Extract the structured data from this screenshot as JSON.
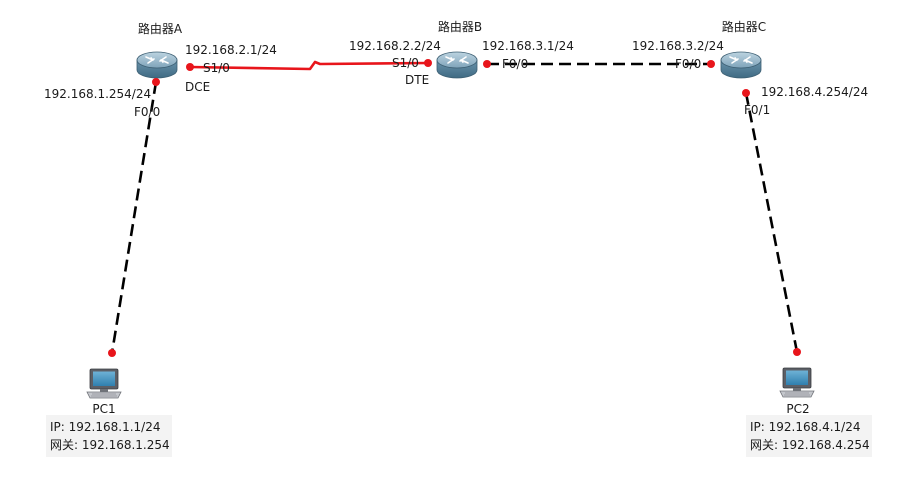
{
  "diagram": {
    "nodes": {
      "router_a": {
        "name": "路由器A"
      },
      "router_b": {
        "name": "路由器B"
      },
      "router_c": {
        "name": "路由器C"
      },
      "pc1": {
        "name": "PC1",
        "ip": "IP: 192.168.1.1/24",
        "gateway": "网关: 192.168.1.254"
      },
      "pc2": {
        "name": "PC2",
        "ip": "IP: 192.168.4.1/24",
        "gateway": "网关: 192.168.4.254"
      }
    },
    "interfaces": {
      "a_s10": {
        "port": "S1/0",
        "ip": "192.168.2.1/24",
        "role": "DCE"
      },
      "a_f00": {
        "port": "F0/0",
        "ip": "192.168.1.254/24"
      },
      "b_s10": {
        "port": "S1/0",
        "ip": "192.168.2.2/24",
        "role": "DTE"
      },
      "b_f00": {
        "port": "F0/0",
        "ip": "192.168.3.1/24"
      },
      "c_f00": {
        "port": "F0/0",
        "ip": "192.168.3.2/24"
      },
      "c_f01": {
        "port": "F0/1",
        "ip": "192.168.4.254/24"
      }
    },
    "colors": {
      "serial_link": "#e8151b",
      "ethernet_link": "#000000",
      "port_dot": "#e8151b",
      "router_body": "#5f8aa3",
      "label_text": "#1a1a1a"
    }
  }
}
